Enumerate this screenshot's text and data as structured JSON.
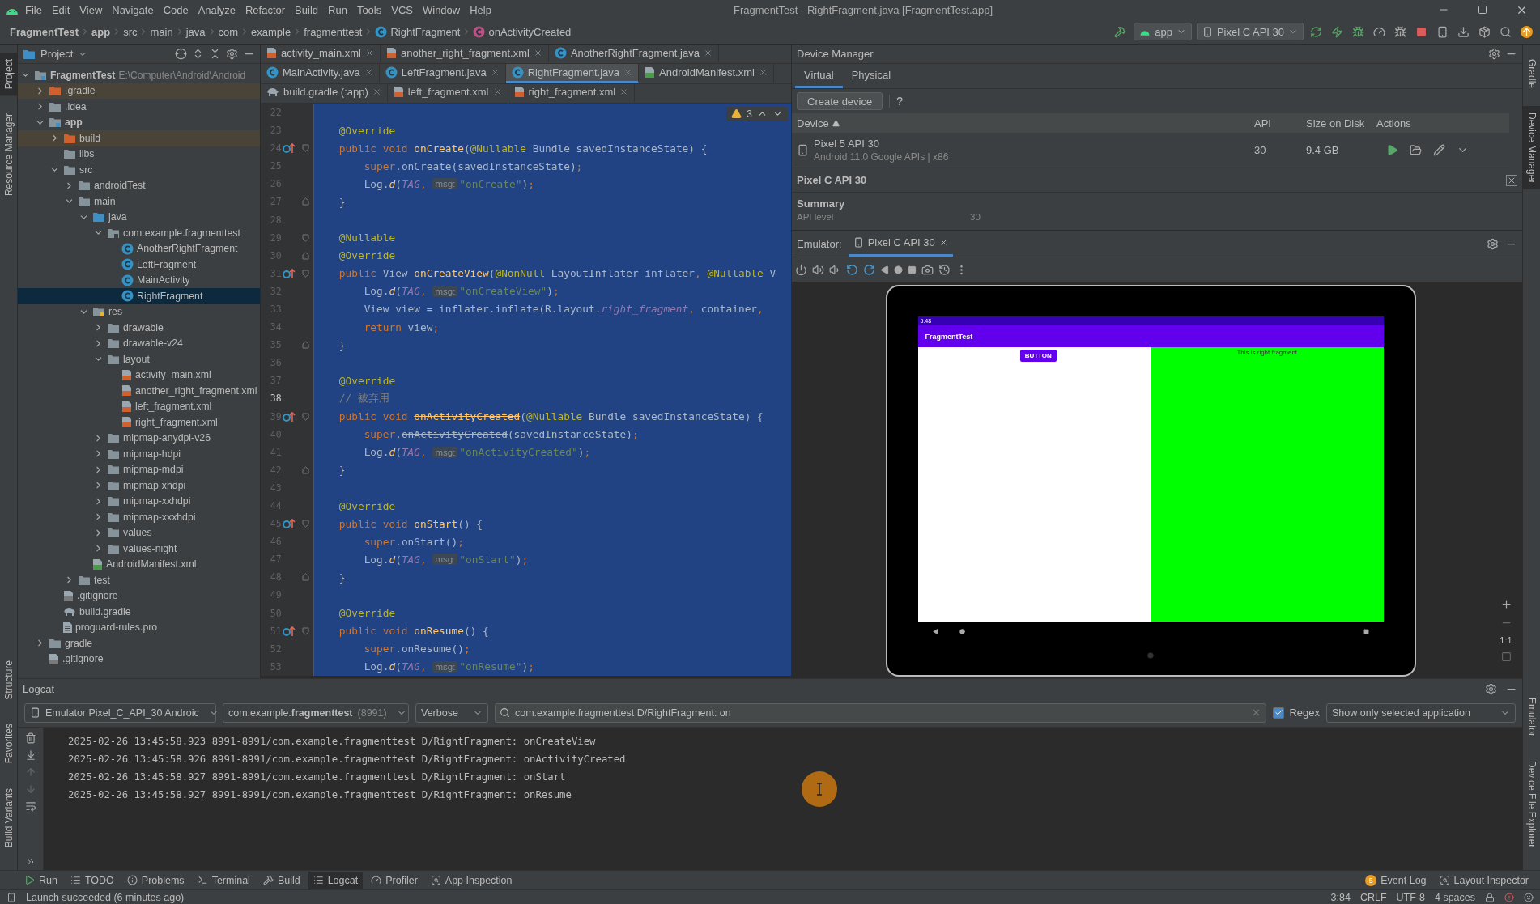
{
  "menu_bar": {
    "items": [
      "File",
      "Edit",
      "View",
      "Navigate",
      "Code",
      "Analyze",
      "Refactor",
      "Build",
      "Run",
      "Tools",
      "VCS",
      "Window",
      "Help"
    ],
    "title": "FragmentTest - RightFragment.java [FragmentTest.app]"
  },
  "nav_bar": {
    "breadcrumbs": [
      {
        "label": "FragmentTest",
        "kind": "module"
      },
      {
        "label": "app",
        "kind": "module"
      },
      {
        "label": "src",
        "kind": "folder"
      },
      {
        "label": "main",
        "kind": "folder"
      },
      {
        "label": "java",
        "kind": "folder"
      },
      {
        "label": "com",
        "kind": "folder"
      },
      {
        "label": "example",
        "kind": "folder"
      },
      {
        "label": "fragmenttest",
        "kind": "folder"
      },
      {
        "label": "RightFragment",
        "kind": "class"
      },
      {
        "label": "onActivityCreated",
        "kind": "method"
      }
    ],
    "run_config": "app",
    "device": "Pixel C API 30"
  },
  "left_stripe": {
    "top": [
      {
        "label": "Project",
        "selected": true
      },
      {
        "label": "Resource Manager",
        "selected": false
      }
    ],
    "bottom": [
      {
        "label": "Structure",
        "selected": false
      },
      {
        "label": "Favorites",
        "selected": false
      },
      {
        "label": "Build Variants",
        "selected": false
      }
    ]
  },
  "right_stripe": {
    "top": [
      {
        "label": "Gradle",
        "selected": false
      },
      {
        "label": "Device Manager",
        "selected": true
      }
    ],
    "bottom": [
      {
        "label": "Emulator",
        "selected": false
      },
      {
        "label": "Device File Explorer",
        "selected": false
      }
    ]
  },
  "project": {
    "title": "Project",
    "tree": [
      {
        "label": "FragmentTest",
        "path": "E:\\Computer\\Android\\Android",
        "kind": "module",
        "expanded": true,
        "selected": false,
        "children": [
          {
            "label": ".gradle",
            "kind": "excluded",
            "expanded": false,
            "selected": false
          },
          {
            "label": ".idea",
            "kind": "folder",
            "expanded": false,
            "selected": false
          },
          {
            "label": "app",
            "kind": "module",
            "expanded": true,
            "selected": false,
            "children": [
              {
                "label": "build",
                "kind": "excluded",
                "expanded": false,
                "selected": false
              },
              {
                "label": "libs",
                "kind": "folder",
                "selected": false
              },
              {
                "label": "src",
                "kind": "folder",
                "expanded": true,
                "selected": false,
                "children": [
                  {
                    "label": "androidTest",
                    "kind": "folder",
                    "expanded": false,
                    "selected": false
                  },
                  {
                    "label": "main",
                    "kind": "folder",
                    "expanded": true,
                    "selected": false,
                    "children": [
                      {
                        "label": "java",
                        "kind": "source",
                        "expanded": true,
                        "selected": false,
                        "children": [
                          {
                            "label": "com.example.fragmenttest",
                            "kind": "package",
                            "expanded": true,
                            "selected": false,
                            "children": [
                              {
                                "label": "AnotherRightFragment",
                                "kind": "class",
                                "selected": false
                              },
                              {
                                "label": "LeftFragment",
                                "kind": "class",
                                "selected": false
                              },
                              {
                                "label": "MainActivity",
                                "kind": "class",
                                "selected": false
                              },
                              {
                                "label": "RightFragment",
                                "kind": "class",
                                "selected": true
                              }
                            ]
                          }
                        ]
                      },
                      {
                        "label": "res",
                        "kind": "resources",
                        "expanded": true,
                        "selected": false,
                        "children": [
                          {
                            "label": "drawable",
                            "kind": "folder",
                            "expanded": false,
                            "selected": false
                          },
                          {
                            "label": "drawable-v24",
                            "kind": "folder",
                            "expanded": false,
                            "selected": false
                          },
                          {
                            "label": "layout",
                            "kind": "folder",
                            "expanded": true,
                            "selected": false,
                            "children": [
                              {
                                "label": "activity_main.xml",
                                "kind": "xml",
                                "selected": false
                              },
                              {
                                "label": "another_right_fragment.xml",
                                "kind": "xml",
                                "selected": false
                              },
                              {
                                "label": "left_fragment.xml",
                                "kind": "xml",
                                "selected": false
                              },
                              {
                                "label": "right_fragment.xml",
                                "kind": "xml",
                                "selected": false
                              }
                            ]
                          },
                          {
                            "label": "mipmap-anydpi-v26",
                            "kind": "folder",
                            "expanded": false,
                            "selected": false
                          },
                          {
                            "label": "mipmap-hdpi",
                            "kind": "folder",
                            "expanded": false,
                            "selected": false
                          },
                          {
                            "label": "mipmap-mdpi",
                            "kind": "folder",
                            "expanded": false,
                            "selected": false
                          },
                          {
                            "label": "mipmap-xhdpi",
                            "kind": "folder",
                            "expanded": false,
                            "selected": false
                          },
                          {
                            "label": "mipmap-xxhdpi",
                            "kind": "folder",
                            "expanded": false,
                            "selected": false
                          },
                          {
                            "label": "mipmap-xxxhdpi",
                            "kind": "folder",
                            "expanded": false,
                            "selected": false
                          },
                          {
                            "label": "values",
                            "kind": "folder",
                            "expanded": false,
                            "selected": false
                          },
                          {
                            "label": "values-night",
                            "kind": "folder",
                            "expanded": false,
                            "selected": false
                          }
                        ]
                      },
                      {
                        "label": "AndroidManifest.xml",
                        "kind": "manifest",
                        "selected": false
                      }
                    ]
                  },
                  {
                    "label": "test",
                    "kind": "folder",
                    "expanded": false,
                    "selected": false
                  }
                ]
              },
              {
                "label": ".gitignore",
                "kind": "ignore",
                "selected": false
              },
              {
                "label": "build.gradle",
                "kind": "gradle",
                "selected": false
              },
              {
                "label": "proguard-rules.pro",
                "kind": "file",
                "selected": false
              }
            ]
          },
          {
            "label": "gradle",
            "kind": "folder",
            "expanded": false,
            "selected": false
          },
          {
            "label": ".gitignore",
            "kind": "ignore",
            "selected": false
          }
        ]
      }
    ]
  },
  "editor": {
    "tabs": [
      [
        {
          "label": "activity_main.xml",
          "kind": "xml",
          "selected": false
        },
        {
          "label": "another_right_fragment.xml",
          "kind": "xml",
          "selected": false
        },
        {
          "label": "AnotherRightFragment.java",
          "kind": "class",
          "selected": false
        }
      ],
      [
        {
          "label": "MainActivity.java",
          "kind": "class",
          "selected": false
        },
        {
          "label": "LeftFragment.java",
          "kind": "class",
          "selected": false
        },
        {
          "label": "RightFragment.java",
          "kind": "class",
          "selected": true
        },
        {
          "label": "AndroidManifest.xml",
          "kind": "manifest",
          "selected": false
        }
      ],
      [
        {
          "label": "build.gradle (:app)",
          "kind": "gradle",
          "selected": false
        },
        {
          "label": "left_fragment.xml",
          "kind": "xml",
          "selected": false
        },
        {
          "label": "right_fragment.xml",
          "kind": "xml",
          "selected": false
        }
      ]
    ],
    "warnings": "3",
    "lines": [
      {
        "n": "22",
        "selected": true,
        "current": false,
        "override": false
      },
      {
        "n": "23",
        "selected": true,
        "current": false,
        "override": false,
        "tokens": [
          {
            "kind": "ann",
            "text": "    @Override"
          }
        ]
      },
      {
        "n": "24",
        "selected": true,
        "current": false,
        "override": true,
        "kind": "fold-start",
        "tokens": [
          {
            "kind": "kw",
            "text": "    public void "
          },
          {
            "kind": "fn",
            "text": "onCreate"
          },
          {
            "kind": "plain",
            "text": "("
          },
          {
            "kind": "ann",
            "text": "@Nullable "
          },
          {
            "kind": "plain",
            "text": "Bundle savedInstanceState) {"
          }
        ]
      },
      {
        "n": "25",
        "selected": true,
        "current": false,
        "override": false,
        "tokens": [
          {
            "kind": "kw",
            "text": "        super"
          },
          {
            "kind": "plain",
            "text": ".onCreate(savedInstanceState)"
          },
          {
            "kind": "kw",
            "text": ";"
          }
        ]
      },
      {
        "n": "26",
        "selected": true,
        "current": false,
        "override": false,
        "tokens": [
          {
            "kind": "plain",
            "text": "        Log."
          },
          {
            "kind": "it",
            "text": "d"
          },
          {
            "kind": "plain",
            "text": "("
          },
          {
            "kind": "field",
            "text": "TAG"
          },
          {
            "kind": "kw",
            "text": ", "
          },
          {
            "kind": "hint",
            "text": "msg:"
          },
          {
            "kind": "str",
            "text": "\"onCreate\""
          },
          {
            "kind": "plain",
            "text": ")"
          },
          {
            "kind": "kw",
            "text": ";"
          }
        ]
      },
      {
        "n": "27",
        "selected": true,
        "current": false,
        "override": false,
        "kind": "fold-end",
        "tokens": [
          {
            "kind": "plain",
            "text": "    }"
          }
        ]
      },
      {
        "n": "28",
        "selected": true,
        "current": false,
        "override": false
      },
      {
        "n": "29",
        "selected": true,
        "current": false,
        "override": false,
        "kind": "fold-start",
        "tokens": [
          {
            "kind": "ann",
            "text": "    @Nullable"
          }
        ]
      },
      {
        "n": "30",
        "selected": true,
        "current": false,
        "override": false,
        "kind": "fold-end",
        "tokens": [
          {
            "kind": "ann",
            "text": "    @Override"
          }
        ]
      },
      {
        "n": "31",
        "selected": true,
        "current": false,
        "override": true,
        "kind": "fold-start",
        "tokens": [
          {
            "kind": "kw",
            "text": "    public "
          },
          {
            "kind": "plain",
            "text": "View "
          },
          {
            "kind": "fn",
            "text": "onCreateView"
          },
          {
            "kind": "plain",
            "text": "("
          },
          {
            "kind": "ann",
            "text": "@NonNull "
          },
          {
            "kind": "plain",
            "text": "LayoutInflater inflater"
          },
          {
            "kind": "kw",
            "text": ", "
          },
          {
            "kind": "ann",
            "text": "@Nullable "
          },
          {
            "kind": "plain",
            "text": "V"
          }
        ]
      },
      {
        "n": "32",
        "selected": true,
        "current": false,
        "override": false,
        "tokens": [
          {
            "kind": "plain",
            "text": "        Log."
          },
          {
            "kind": "it",
            "text": "d"
          },
          {
            "kind": "plain",
            "text": "("
          },
          {
            "kind": "field",
            "text": "TAG"
          },
          {
            "kind": "kw",
            "text": ", "
          },
          {
            "kind": "hint",
            "text": "msg:"
          },
          {
            "kind": "str",
            "text": "\"onCreateView\""
          },
          {
            "kind": "plain",
            "text": ")"
          },
          {
            "kind": "kw",
            "text": ";"
          }
        ]
      },
      {
        "n": "33",
        "selected": true,
        "current": false,
        "override": false,
        "tokens": [
          {
            "kind": "plain",
            "text": "        View view = inflater.inflate(R.layout."
          },
          {
            "kind": "field",
            "text": "right_fragment"
          },
          {
            "kind": "kw",
            "text": ", "
          },
          {
            "kind": "plain",
            "text": "container"
          },
          {
            "kind": "kw",
            "text": ","
          }
        ]
      },
      {
        "n": "34",
        "selected": true,
        "current": false,
        "override": false,
        "tokens": [
          {
            "kind": "kw",
            "text": "        return "
          },
          {
            "kind": "plain",
            "text": "view"
          },
          {
            "kind": "kw",
            "text": ";"
          }
        ]
      },
      {
        "n": "35",
        "selected": true,
        "current": false,
        "override": false,
        "kind": "fold-end",
        "tokens": [
          {
            "kind": "plain",
            "text": "    }"
          }
        ]
      },
      {
        "n": "36",
        "selected": true,
        "current": false,
        "override": false
      },
      {
        "n": "37",
        "selected": true,
        "current": false,
        "override": false,
        "tokens": [
          {
            "kind": "ann",
            "text": "    @Override"
          }
        ]
      },
      {
        "n": "38",
        "selected": true,
        "current": true,
        "override": false,
        "tokens": [
          {
            "kind": "cmt",
            "text": "    // 被弃用"
          }
        ]
      },
      {
        "n": "39",
        "selected": true,
        "current": false,
        "override": true,
        "kind": "fold-start",
        "tokens": [
          {
            "kind": "kw",
            "text": "    public void "
          },
          {
            "kind": "dep",
            "text": "onActivityCreated"
          },
          {
            "kind": "plain",
            "text": "("
          },
          {
            "kind": "ann",
            "text": "@Nullable "
          },
          {
            "kind": "plain",
            "text": "Bundle savedInstanceState) {"
          }
        ]
      },
      {
        "n": "40",
        "selected": true,
        "current": false,
        "override": false,
        "tokens": [
          {
            "kind": "kw",
            "text": "        super"
          },
          {
            "kind": "plain",
            "text": "."
          },
          {
            "kind": "depplain",
            "text": "onActivityCreated"
          },
          {
            "kind": "plain",
            "text": "(savedInstanceState)"
          },
          {
            "kind": "kw",
            "text": ";"
          }
        ]
      },
      {
        "n": "41",
        "selected": true,
        "current": false,
        "override": false,
        "tokens": [
          {
            "kind": "plain",
            "text": "        Log."
          },
          {
            "kind": "it",
            "text": "d"
          },
          {
            "kind": "plain",
            "text": "("
          },
          {
            "kind": "field",
            "text": "TAG"
          },
          {
            "kind": "kw",
            "text": ", "
          },
          {
            "kind": "hint",
            "text": "msg:"
          },
          {
            "kind": "str",
            "text": "\"onActivityCreated\""
          },
          {
            "kind": "plain",
            "text": ")"
          },
          {
            "kind": "kw",
            "text": ";"
          }
        ]
      },
      {
        "n": "42",
        "selected": true,
        "current": false,
        "override": false,
        "kind": "fold-end",
        "tokens": [
          {
            "kind": "plain",
            "text": "    }"
          }
        ]
      },
      {
        "n": "43",
        "selected": true,
        "current": false,
        "override": false
      },
      {
        "n": "44",
        "selected": true,
        "current": false,
        "override": false,
        "tokens": [
          {
            "kind": "ann",
            "text": "    @Override"
          }
        ]
      },
      {
        "n": "45",
        "selected": true,
        "current": false,
        "override": true,
        "kind": "fold-start",
        "tokens": [
          {
            "kind": "kw",
            "text": "    public void "
          },
          {
            "kind": "fn",
            "text": "onStart"
          },
          {
            "kind": "plain",
            "text": "() {"
          }
        ]
      },
      {
        "n": "46",
        "selected": true,
        "current": false,
        "override": false,
        "tokens": [
          {
            "kind": "kw",
            "text": "        super"
          },
          {
            "kind": "plain",
            "text": ".onStart()"
          },
          {
            "kind": "kw",
            "text": ";"
          }
        ]
      },
      {
        "n": "47",
        "selected": true,
        "current": false,
        "override": false,
        "tokens": [
          {
            "kind": "plain",
            "text": "        Log."
          },
          {
            "kind": "it",
            "text": "d"
          },
          {
            "kind": "plain",
            "text": "("
          },
          {
            "kind": "field",
            "text": "TAG"
          },
          {
            "kind": "kw",
            "text": ", "
          },
          {
            "kind": "hint",
            "text": "msg:"
          },
          {
            "kind": "str",
            "text": "\"onStart\""
          },
          {
            "kind": "plain",
            "text": ")"
          },
          {
            "kind": "kw",
            "text": ";"
          }
        ]
      },
      {
        "n": "48",
        "selected": true,
        "current": false,
        "override": false,
        "kind": "fold-end",
        "tokens": [
          {
            "kind": "plain",
            "text": "    }"
          }
        ]
      },
      {
        "n": "49",
        "selected": true,
        "current": false,
        "override": false
      },
      {
        "n": "50",
        "selected": true,
        "current": false,
        "override": false,
        "tokens": [
          {
            "kind": "ann",
            "text": "    @Override"
          }
        ]
      },
      {
        "n": "51",
        "selected": true,
        "current": false,
        "override": true,
        "kind": "fold-start",
        "tokens": [
          {
            "kind": "kw",
            "text": "    public void "
          },
          {
            "kind": "fn",
            "text": "onResume"
          },
          {
            "kind": "plain",
            "text": "() {"
          }
        ]
      },
      {
        "n": "52",
        "selected": true,
        "current": false,
        "override": false,
        "tokens": [
          {
            "kind": "kw",
            "text": "        super"
          },
          {
            "kind": "plain",
            "text": ".onResume()"
          },
          {
            "kind": "kw",
            "text": ";"
          }
        ]
      },
      {
        "n": "53",
        "selected": true,
        "current": false,
        "override": false,
        "tokens": [
          {
            "kind": "plain",
            "text": "        Log."
          },
          {
            "kind": "it",
            "text": "d"
          },
          {
            "kind": "plain",
            "text": "("
          },
          {
            "kind": "field",
            "text": "TAG"
          },
          {
            "kind": "kw",
            "text": ", "
          },
          {
            "kind": "hint",
            "text": "msg:"
          },
          {
            "kind": "str",
            "text": "\"onResume\""
          },
          {
            "kind": "plain",
            "text": ")"
          },
          {
            "kind": "kw",
            "text": ";"
          }
        ]
      }
    ]
  },
  "device_manager": {
    "title": "Device Manager",
    "tabs": [
      {
        "label": "Virtual",
        "selected": true
      },
      {
        "label": "Physical",
        "selected": false
      }
    ],
    "create_button": "Create device",
    "help": "?",
    "columns": [
      "Device",
      "API",
      "Size on Disk",
      "Actions"
    ],
    "rows": [
      {
        "name": "Pixel 5 API 30",
        "detail": "Android 11.0 Google APIs | x86",
        "api": "30",
        "size": "9.4 GB"
      }
    ],
    "details": {
      "title": "Pixel C API 30",
      "section": "Summary",
      "fields": [
        {
          "label": "API level",
          "value": "30"
        }
      ]
    }
  },
  "emulator": {
    "label": "Emulator:",
    "tabs": [
      {
        "label": "Pixel C API 30",
        "selected": true
      }
    ],
    "screen": {
      "time": "5:48",
      "app_title": "FragmentTest",
      "button": "BUTTON",
      "right_text": "This is right fragment"
    },
    "zoom": {
      "actual_size": "1:1"
    }
  },
  "logcat": {
    "title": "Logcat",
    "device": "Emulator Pixel_C_API_30 Androic",
    "process": "com.example.**fragmenttest**",
    "pid": "(8991)",
    "level": "Verbose",
    "search": "com.example.fragmenttest D/RightFragment: on",
    "regex": {
      "label": "Regex",
      "checked": true
    },
    "filter": "Show only selected application",
    "lines": [
      "2025-02-26 13:45:58.923 8991-8991/com.example.fragmenttest D/RightFragment: onCreateView",
      "2025-02-26 13:45:58.926 8991-8991/com.example.fragmenttest D/RightFragment: onActivityCreated",
      "2025-02-26 13:45:58.927 8991-8991/com.example.fragmenttest D/RightFragment: onStart",
      "2025-02-26 13:45:58.927 8991-8991/com.example.fragmenttest D/RightFragment: onResume"
    ]
  },
  "tool_windows": {
    "left": [
      {
        "label": "Run",
        "kind": "run",
        "selected": false
      },
      {
        "label": "TODO",
        "kind": "list",
        "selected": false
      },
      {
        "label": "Problems",
        "kind": "info",
        "selected": false
      },
      {
        "label": "Terminal",
        "kind": "terminal",
        "selected": false
      },
      {
        "label": "Build",
        "kind": "hammer",
        "selected": false
      },
      {
        "label": "Logcat",
        "kind": "list",
        "selected": true
      },
      {
        "label": "Profiler",
        "kind": "gauge",
        "selected": false
      },
      {
        "label": "App Inspection",
        "kind": "inspect",
        "selected": false
      }
    ],
    "right": [
      {
        "label": "Event Log",
        "kind": "event",
        "badge": "5",
        "selected": false
      },
      {
        "label": "Layout Inspector",
        "kind": "inspect",
        "selected": false
      }
    ]
  },
  "status_bar": {
    "message": "Launch succeeded (6 minutes ago)",
    "position": "3:84",
    "line_separator": "CRLF",
    "encoding": "UTF-8",
    "indent": "4 spaces"
  }
}
